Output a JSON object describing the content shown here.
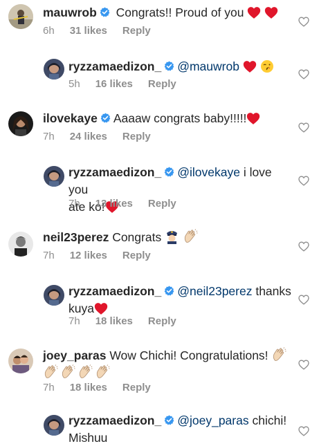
{
  "comments": [
    {
      "username": "mauwrob",
      "verified": true,
      "text": " Congrats!! Proud of you ",
      "time": "6h",
      "likes": "31 likes",
      "reply": "Reply"
    },
    {
      "username": "ryzzamaedizon_",
      "verified": true,
      "mention": "@mauwrob",
      "text": "",
      "time": "5h",
      "likes": "16 likes",
      "reply": "Reply"
    },
    {
      "username": "ilovekaye",
      "verified": true,
      "text": "Aaaaw congrats baby!!!!!",
      "time": "7h",
      "likes": "24 likes",
      "reply": "Reply"
    },
    {
      "username": "ryzzamaedizon_",
      "verified": true,
      "mention": "@ilovekaye",
      "text": " i love you",
      "text2": "ate ko!",
      "time": "7h",
      "likes": "13 likes",
      "reply": "Reply"
    },
    {
      "username": "neil23perez",
      "verified": false,
      "text": " Congrats ",
      "time": "7h",
      "likes": "12 likes",
      "reply": "Reply"
    },
    {
      "username": "ryzzamaedizon_",
      "verified": true,
      "mention": "@neil23perez",
      "text": " thanks",
      "text2": "kuya",
      "time": "7h",
      "likes": "18 likes",
      "reply": "Reply"
    },
    {
      "username": "joey_paras",
      "verified": false,
      "text": " Wow Chichi! Congratulations! ",
      "time": "7h",
      "likes": "18 likes",
      "reply": "Reply"
    },
    {
      "username": "ryzzamaedizon_",
      "verified": true,
      "mention": "@joey_paras",
      "text": " chichi!",
      "text2": "Mishuu"
    }
  ],
  "colors": {
    "text": "#262626",
    "meta": "#8e8e8e",
    "mention": "#00376b",
    "verified": "#3897f0",
    "heart_emoji": "#e0162b"
  }
}
